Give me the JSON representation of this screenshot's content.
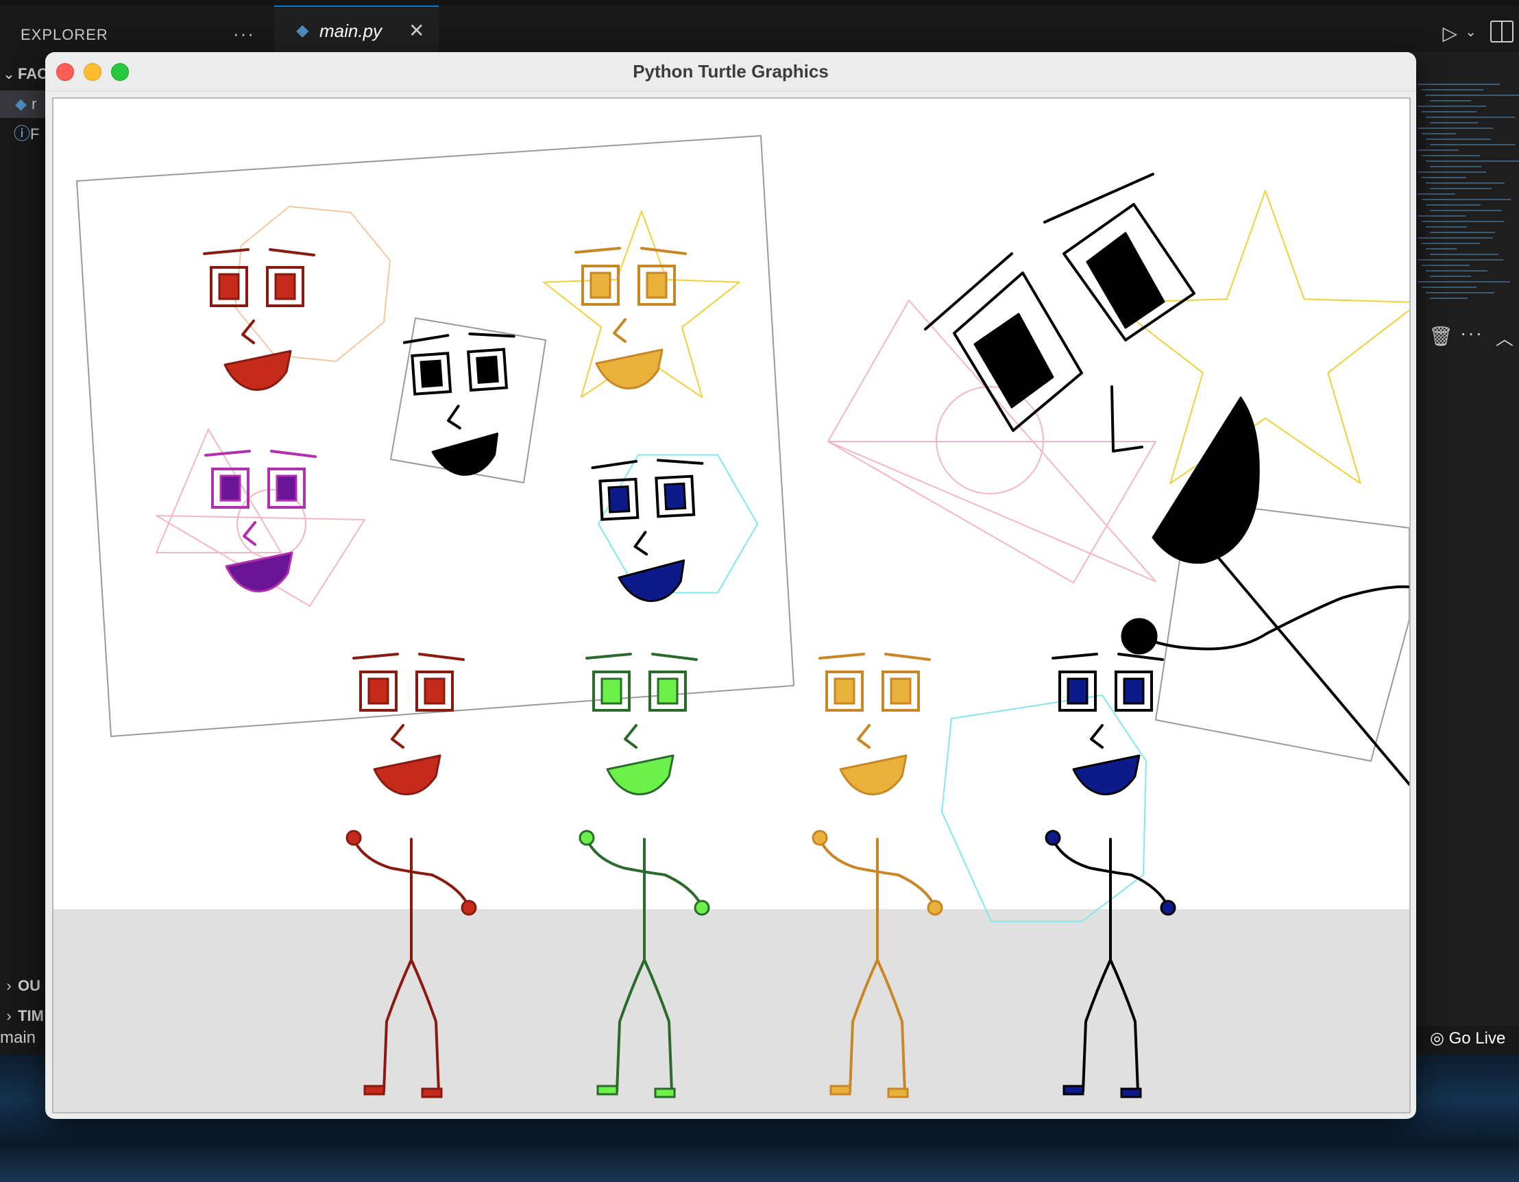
{
  "editor": {
    "explorer_title": "EXPLORER",
    "explorer_more": "···",
    "folder_label": "FAC",
    "file_row_1": "r",
    "file_row_2": "F",
    "outline_label": "OU",
    "timeline_label": "TIM",
    "status_left": "main",
    "active_tab": "main.py",
    "tab_close": "✕",
    "status_right": "Go Live"
  },
  "window": {
    "title": "Python Turtle Graphics",
    "traffic_lights": [
      "close",
      "minimize",
      "zoom"
    ]
  },
  "colors": {
    "red": "#c62a1a",
    "dark_red": "#8a1a10",
    "orange": "#e8b23a",
    "dark_orange": "#c98625",
    "blue": "#0d1b8a",
    "purple": "#6a1596",
    "magenta": "#b32fb0",
    "green": "#6cf04a",
    "dark_green": "#2a6a2a",
    "black": "#000000",
    "ground": "#e0e0e0",
    "star_yellow": "#f2d038",
    "triangle_pink": "#f4b6c2",
    "hex_cyan": "#7ee8ef",
    "octagon_peach": "#f7c6a0"
  },
  "scene": {
    "icons": [
      "python-file-icon",
      "info-icon",
      "play-icon",
      "split-editor-icon",
      "trash-icon",
      "broadcast-icon"
    ],
    "portrait_frame": "tilted rectangle containing four faces",
    "portrait_faces": [
      "red face on octagon",
      "orange face on star",
      "black face on square",
      "purple face on triangles and circle",
      "blue face on hexagon"
    ],
    "big_face": "large black face with star, triangle, circle, square",
    "stick_figures": [
      "red",
      "green",
      "orange",
      "blue"
    ]
  }
}
